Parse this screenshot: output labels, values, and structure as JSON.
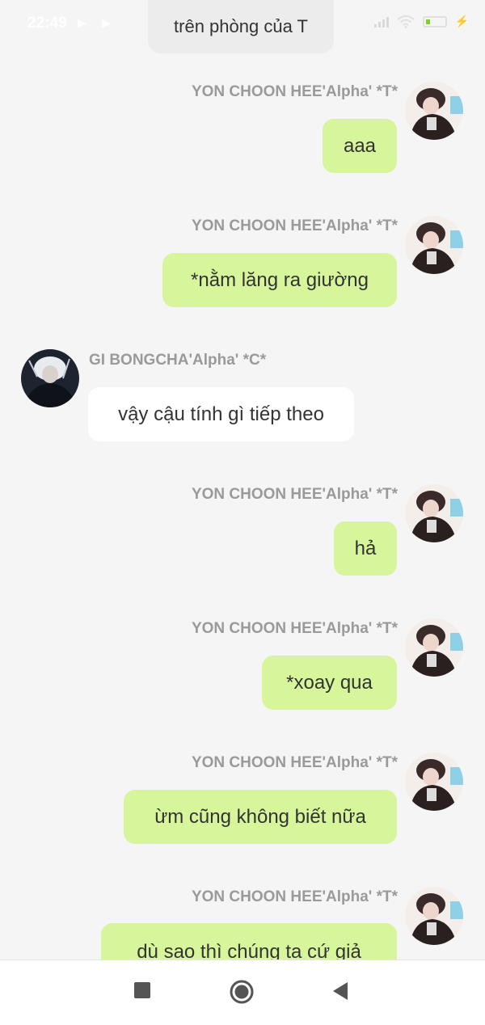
{
  "status_bar": {
    "time": "22:49"
  },
  "scene": {
    "label": "trên phòng của T"
  },
  "messages": [
    {
      "sender": "YON CHOON HEE'Alpha' *T*",
      "text": "aaa",
      "side": "right"
    },
    {
      "sender": "YON CHOON HEE'Alpha' *T*",
      "text": "*nằm lăng ra giường",
      "side": "right"
    },
    {
      "sender": "GI BONGCHA'Alpha' *C*",
      "text": "vậy cậu tính gì tiếp theo",
      "side": "left"
    },
    {
      "sender": "YON CHOON HEE'Alpha' *T*",
      "text": "hả",
      "side": "right"
    },
    {
      "sender": "YON CHOON HEE'Alpha' *T*",
      "text": "*xoay qua",
      "side": "right"
    },
    {
      "sender": "YON CHOON HEE'Alpha' *T*",
      "text": "ừm cũng không biết nữa",
      "side": "right"
    },
    {
      "sender": "YON CHOON HEE'Alpha' *T*",
      "text": "dù sao thì chúng ta cứ giả",
      "side": "right"
    }
  ],
  "colors": {
    "outgoing_bubble": "#d7f59a",
    "incoming_bubble": "#ffffff",
    "background": "#f5f5f5"
  }
}
